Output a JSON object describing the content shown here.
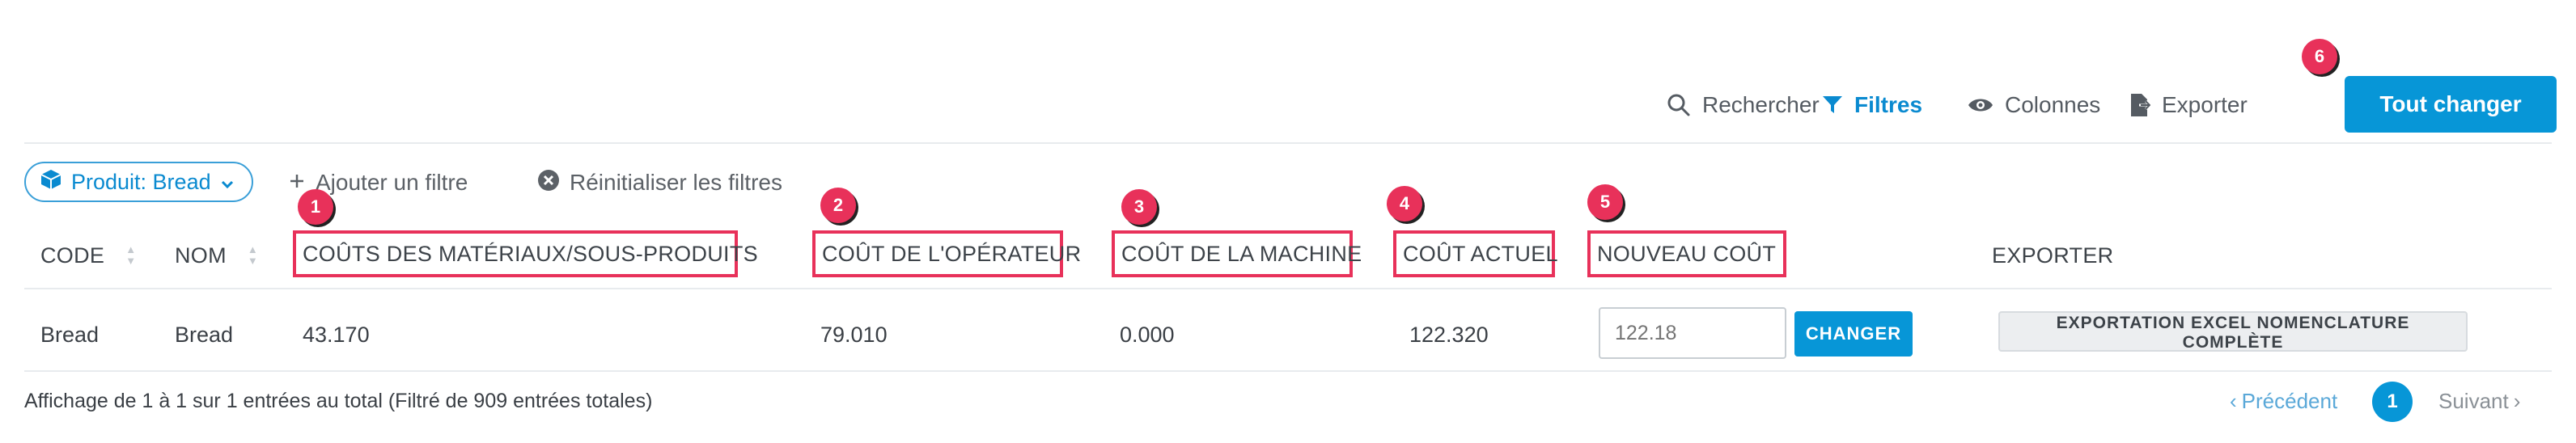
{
  "toolbar": {
    "search_label": "Rechercher",
    "filters_label": "Filtres",
    "columns_label": "Colonnes",
    "export_label": "Exporter",
    "change_all_label": "Tout changer"
  },
  "filters": {
    "chip_label": "Produit: Bread",
    "add_filter_label": "Ajouter un filtre",
    "reset_label": "Réinitialiser les filtres"
  },
  "table": {
    "headers": {
      "code": "CODE",
      "name": "NOM",
      "materials_cost": "COÛTS DES MATÉRIAUX/SOUS-PRODUITS",
      "operator_cost": "COÛT DE L'OPÉRATEUR",
      "machine_cost": "COÛT DE LA MACHINE",
      "current_cost": "COÛT ACTUEL",
      "new_cost": "NOUVEAU COÛT",
      "export": "EXPORTER"
    },
    "rows": [
      {
        "code": "Bread",
        "name": "Bread",
        "materials_cost": "43.170",
        "operator_cost": "79.010",
        "machine_cost": "0.000",
        "current_cost": "122.320",
        "new_cost_placeholder": "122.18",
        "change_label": "CHANGER",
        "export_label": "EXPORTATION EXCEL NOMENCLATURE COMPLÈTE"
      }
    ]
  },
  "annotations": [
    "1",
    "2",
    "3",
    "4",
    "5",
    "6"
  ],
  "footer": {
    "info": "Affichage de 1 à 1 sur 1 entrées au total (Filtré de 909 entrées totales)",
    "prev_label": "Précédent",
    "current_page": "1",
    "next_label": "Suivant"
  },
  "colors": {
    "primary": "#0796d7",
    "annotation": "#e8315a"
  },
  "icons": [
    "search-icon",
    "filter-icon",
    "eye-icon",
    "export-icon",
    "cube-icon",
    "chevron-down-icon",
    "plus-icon",
    "close-circle-icon",
    "sort-icon",
    "chevron-left-icon",
    "chevron-right-icon"
  ]
}
